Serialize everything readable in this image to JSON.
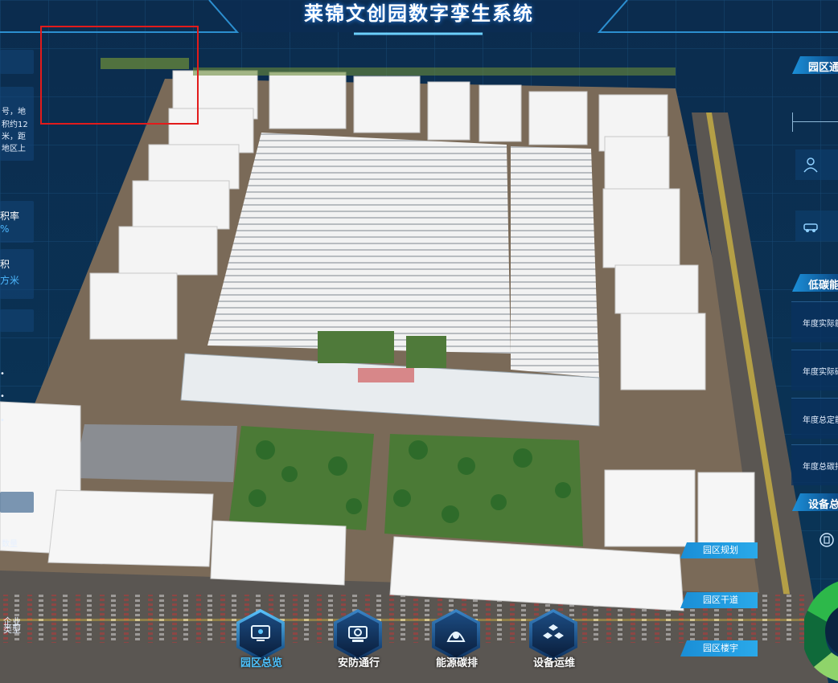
{
  "header": {
    "title": "莱锦文创园数字孪生系统"
  },
  "left_panel": {
    "intro_lines": [
      "号，地",
      "积约12",
      "米，距",
      "地区上"
    ],
    "stat1_label": "积率",
    "stat1_value": "%",
    "stat2_label": "积",
    "stat2_value": "方米",
    "legend_dots": [
      "•",
      "•",
      "•",
      "•"
    ],
    "count_label": "数量",
    "enterprise_label": "企业",
    "type_label": "类型"
  },
  "right_panel": {
    "section1_title": "园区通",
    "section2_title": "低碳能",
    "energy_rows": [
      "年度实际能",
      "年度实际碳",
      "年度总定能",
      "年度总碳排"
    ],
    "section3_title": "设备总",
    "donut_colors": [
      "#2db84a",
      "#0f6a3a",
      "#8fd46a",
      "#e8e8e8"
    ]
  },
  "map_labels": [
    "园区规划",
    "园区干道",
    "园区楼宇"
  ],
  "bottom_nav": [
    {
      "label": "园区总览",
      "icon": "monitor-icon",
      "active": true
    },
    {
      "label": "安防通行",
      "icon": "camera-icon",
      "active": false
    },
    {
      "label": "能源碳排",
      "icon": "energy-icon",
      "active": false
    },
    {
      "label": "设备运维",
      "icon": "cubes-icon",
      "active": false
    }
  ],
  "colors": {
    "accent": "#2aa9ea",
    "nav_active": "#4dc3ff",
    "selection": "#e21b1b"
  }
}
